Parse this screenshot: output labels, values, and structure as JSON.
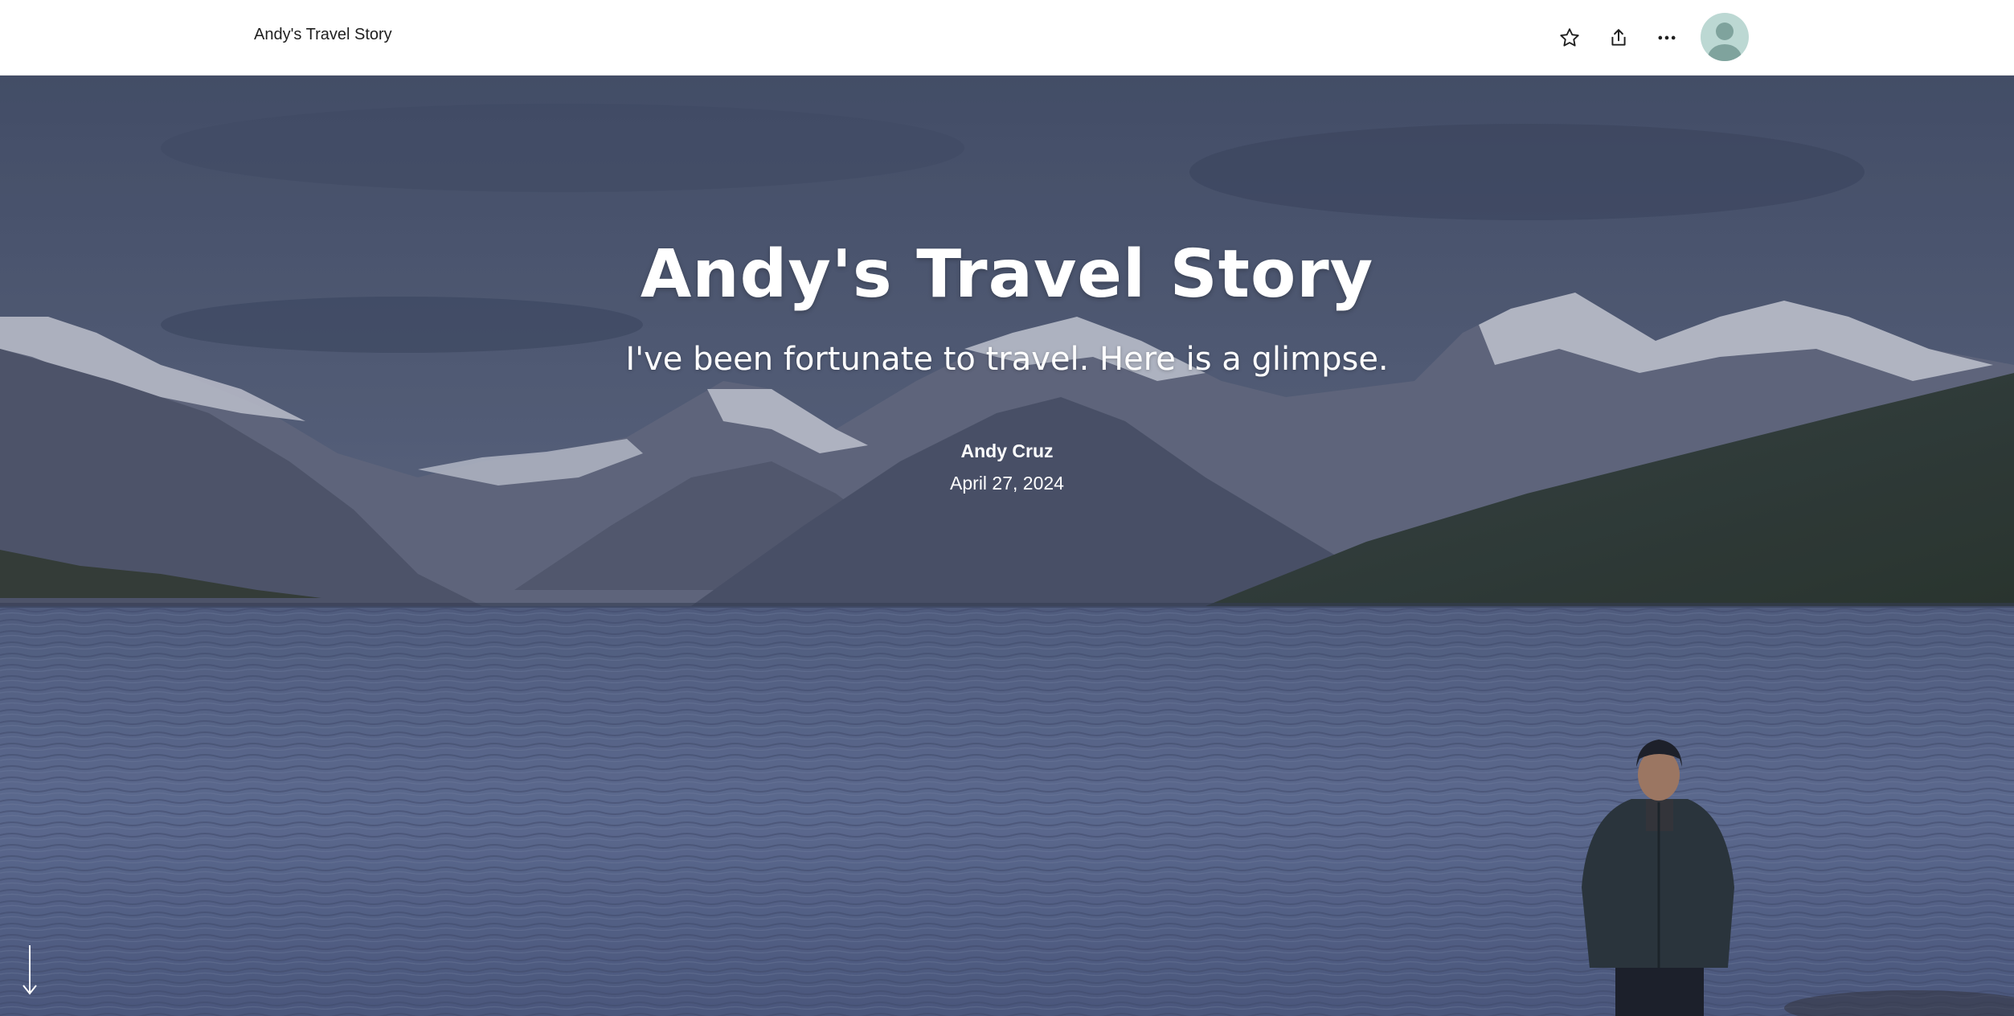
{
  "header": {
    "title": "Andy's Travel Story",
    "icons": [
      "star-icon",
      "share-icon",
      "more-icon",
      "avatar"
    ]
  },
  "hero": {
    "title": "Andy's Travel Story",
    "subtitle": "I've been fortunate to travel. Here is a glimpse.",
    "author": "Andy Cruz",
    "date": "April 27, 2024"
  },
  "colors": {
    "header_bg": "#ffffff",
    "hero_text": "#ffffff",
    "avatar_bg": "#bcd8d3"
  }
}
